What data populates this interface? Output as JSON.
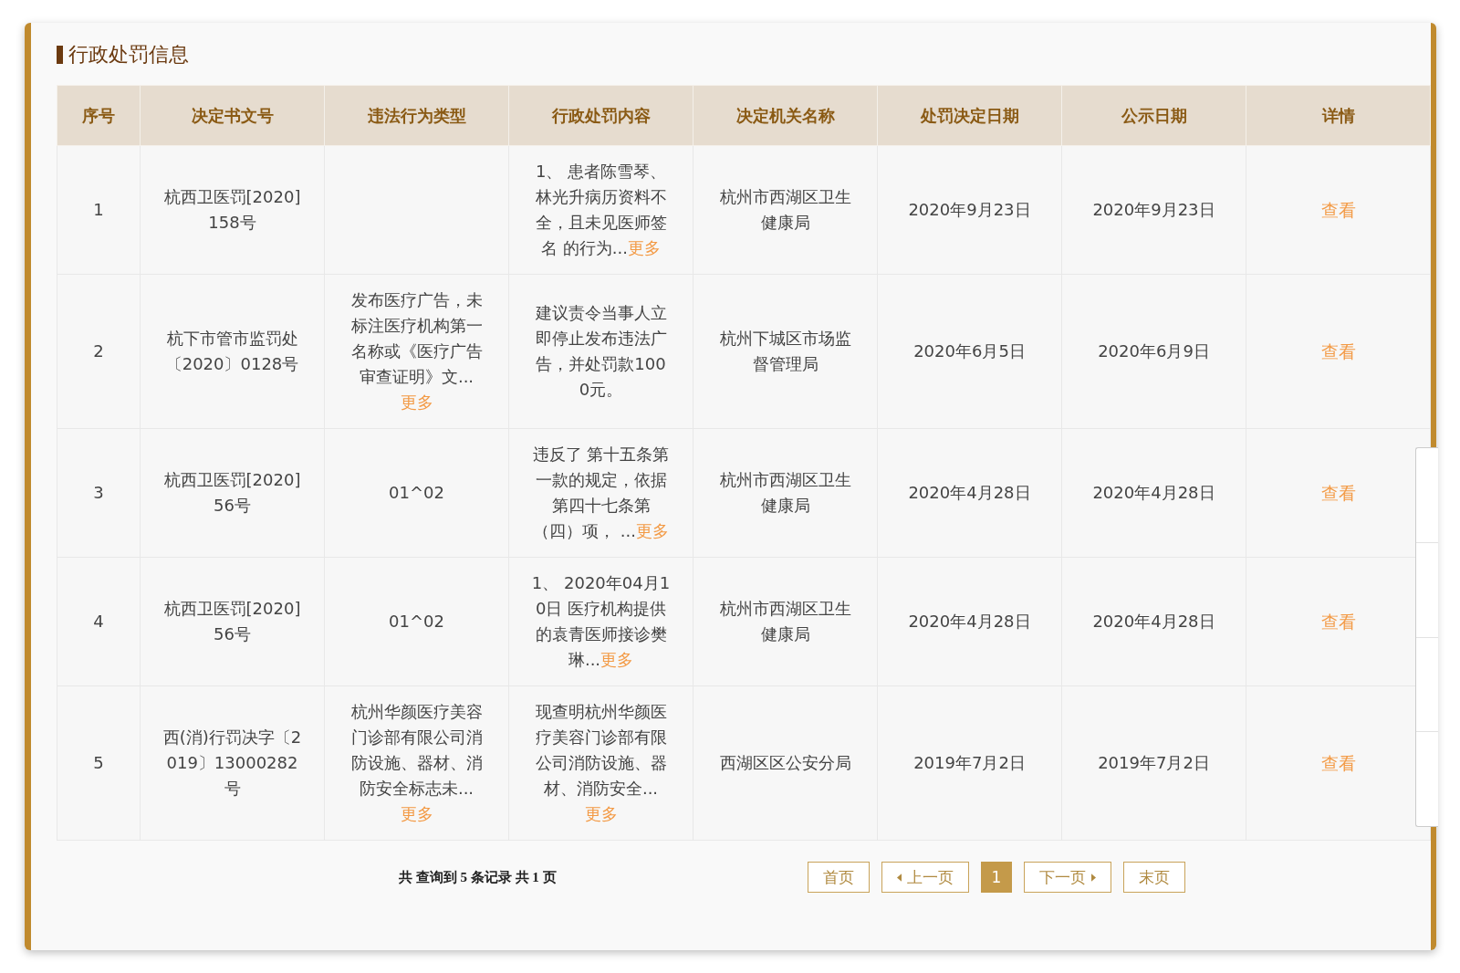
{
  "section_title": "行政处罚信息",
  "table": {
    "columns": [
      "序号",
      "决定书文号",
      "违法行为类型",
      "行政处罚内容",
      "决定机关名称",
      "处罚决定日期",
      "公示日期",
      "详情"
    ],
    "rows": [
      {
        "index": "1",
        "decision_no": "杭西卫医罚[2020]158号",
        "violation_type": null,
        "content": {
          "text": "1、 患者陈雪琴、林光升病历资料不全，且未见医师签名 的行为...",
          "more": "更多"
        },
        "authority": "杭州市西湖区卫生健康局",
        "decision_date": "2020年9月23日",
        "publish_date": "2020年9月23日",
        "detail": "查看"
      },
      {
        "index": "2",
        "decision_no": "杭下市管市监罚处〔2020〕0128号",
        "violation_type": {
          "text": "发布医疗广告，未标注医疗机构第一名称或《医疗广告审查证明》文...",
          "more": "更多"
        },
        "content": {
          "text": "建议责令当事人立即停止发布违法广告，并处罚款1000元。"
        },
        "authority": "杭州下城区市场监督管理局",
        "decision_date": "2020年6月5日",
        "publish_date": "2020年6月9日",
        "detail": "查看"
      },
      {
        "index": "3",
        "decision_no": "杭西卫医罚[2020]56号",
        "violation_type": {
          "text": "01^02"
        },
        "content": {
          "text": "违反了 第十五条第一款的规定，依据第四十七条第（四）项， ...",
          "more": "更多"
        },
        "authority": "杭州市西湖区卫生健康局",
        "decision_date": "2020年4月28日",
        "publish_date": "2020年4月28日",
        "detail": "查看"
      },
      {
        "index": "4",
        "decision_no": "杭西卫医罚[2020]56号",
        "violation_type": {
          "text": "01^02"
        },
        "content": {
          "text": "1、 2020年04月10日 医疗机构提供的袁青医师接诊樊琳...",
          "more": "更多"
        },
        "authority": "杭州市西湖区卫生健康局",
        "decision_date": "2020年4月28日",
        "publish_date": "2020年4月28日",
        "detail": "查看"
      },
      {
        "index": "5",
        "decision_no": "西(消)行罚决字〔2019〕13000282号",
        "violation_type": {
          "text": "杭州华颜医疗美容门诊部有限公司消防设施、器材、消防安全标志未...",
          "more": "更多"
        },
        "content": {
          "text": "现查明杭州华颜医疗美容门诊部有限公司消防设施、器材、消防安全...",
          "more": "更多"
        },
        "authority": "西湖区区公安分局",
        "decision_date": "2019年7月2日",
        "publish_date": "2019年7月2日",
        "detail": "查看"
      }
    ]
  },
  "pagination": {
    "summary": "共 查询到 5 条记录 共 1 页",
    "controls": [
      {
        "kind": "button",
        "label": "首页"
      },
      {
        "kind": "prev",
        "label": "上一页"
      },
      {
        "kind": "page",
        "label": "1",
        "selected": true
      },
      {
        "kind": "next",
        "label": "下一页"
      },
      {
        "kind": "button",
        "label": "末页"
      }
    ]
  }
}
